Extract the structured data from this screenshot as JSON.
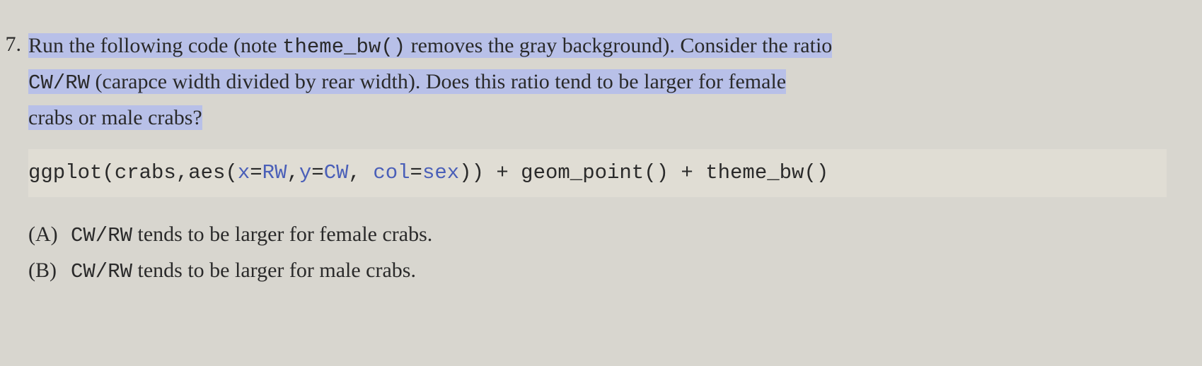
{
  "question": {
    "number": "7.",
    "text_part1": "Run the following code (note ",
    "inline_code1": "theme_bw()",
    "text_part2": " removes the gray background). Consider the ratio",
    "text_part3a": "CW/RW",
    "text_part3b": " (carapce width divided by rear width). Does this ratio tend to be larger for female",
    "text_part4": "crabs or male crabs?"
  },
  "code": {
    "t1": "ggplot(crabs,aes(",
    "t2": "x",
    "t3": "=",
    "t4": "RW",
    "t5": ",",
    "t6": "y",
    "t7": "=",
    "t8": "CW",
    "t9": ", ",
    "t10": "col",
    "t11": "=",
    "t12": "sex",
    "t13": ")) + geom_point() + theme_bw()"
  },
  "options": {
    "a": {
      "label": "(A)",
      "code": "CW/RW",
      "text": " tends to be larger for female crabs."
    },
    "b": {
      "label": "(B)",
      "code": "CW/RW",
      "text": " tends to be larger for male crabs."
    }
  }
}
